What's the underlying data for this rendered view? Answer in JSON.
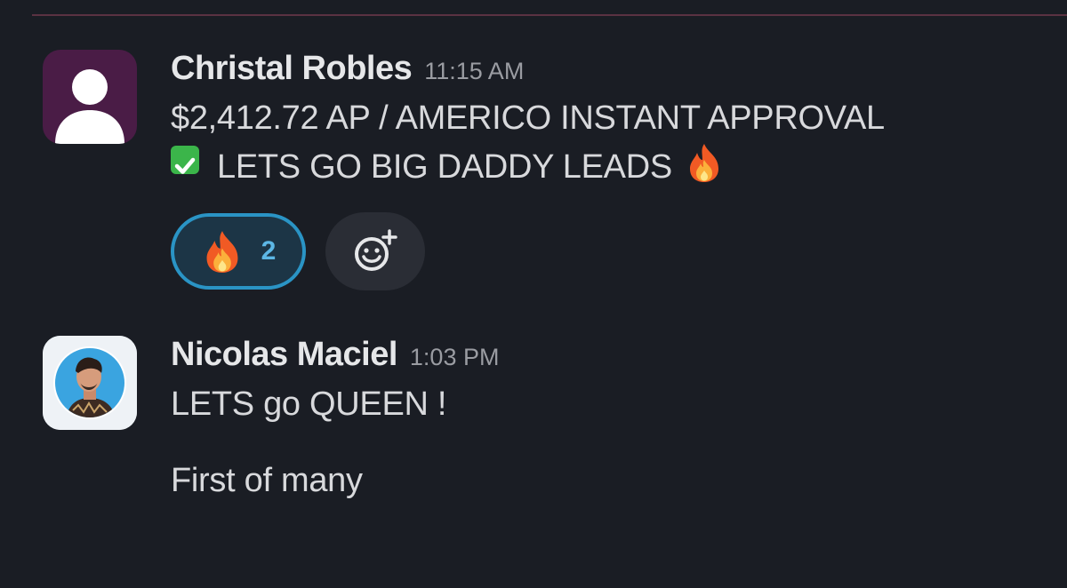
{
  "messages": [
    {
      "author": "Christal Robles",
      "time": "11:15 AM",
      "line1": "$2,412.72 AP / AMERICO INSTANT APPROVAL",
      "line2": "LETS GO BIG DADDY LEADS",
      "avatar_icon": "default-user-icon",
      "reactions": [
        {
          "emoji": "fire",
          "count": "2",
          "selected": true
        }
      ]
    },
    {
      "author": "Nicolas Maciel",
      "time": "1:03 PM",
      "line1": "LETS go QUEEN !",
      "line2": "First of many",
      "avatar_icon": "profile-photo"
    }
  ],
  "colors": {
    "background": "#1a1d24",
    "reaction_border": "#2a94c5",
    "reaction_count": "#5db7e5",
    "check": "#3bb54a"
  }
}
